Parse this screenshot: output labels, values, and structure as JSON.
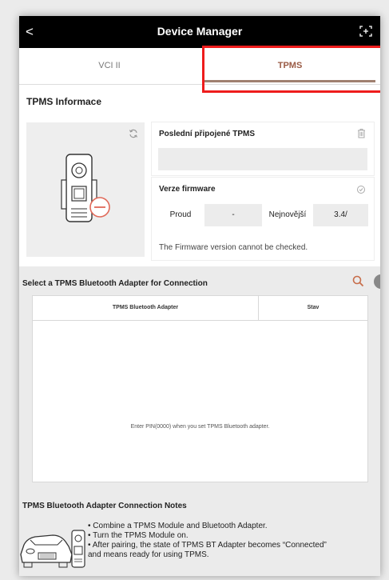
{
  "window": {
    "title": "Device Manager",
    "back_glyph": "<",
    "expand_icon": "expand-icon"
  },
  "tabs": [
    {
      "label": "VCI II",
      "selected": false
    },
    {
      "label": "TPMS",
      "selected": true
    }
  ],
  "tpms_info": {
    "title": "TPMS Informace",
    "last_connected_label": "Poslední připojené TPMS",
    "last_connected_value": "",
    "firmware_label": "Verze firmware",
    "current_label": "Proud",
    "current_value": "-",
    "latest_label": "Nejnovější",
    "latest_value": "3.4/",
    "firmware_note": "The Firmware version cannot be checked."
  },
  "adapter_select": {
    "title": "Select a TPMS Bluetooth Adapter for Connection",
    "columns": [
      "TPMS Bluetooth Adapter",
      "Stav"
    ],
    "rows": [],
    "empty_message": "Enter PIN(0000) when you set TPMS Bluetooth adapter."
  },
  "notes": {
    "title": "TPMS Bluetooth Adapter Connection Notes",
    "items": [
      "• Combine a TPMS Module and Bluetooth Adapter.",
      "• Turn the TPMS Module on.",
      "• After pairing, the state of TPMS BT Adapter becomes “Connected”",
      "and means ready for using TPMS."
    ]
  },
  "colors": {
    "accent": "#c86e4b",
    "highlight": "#ee1c1c",
    "titlebar": "#000000"
  }
}
